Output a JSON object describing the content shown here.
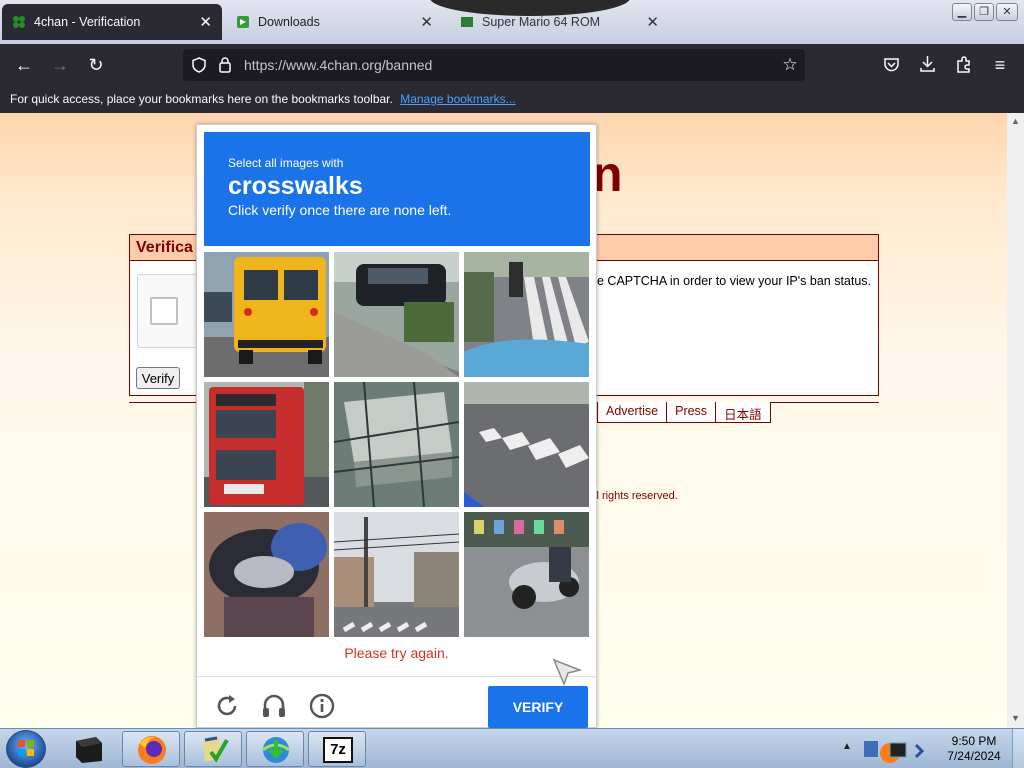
{
  "browser": {
    "tabs": [
      {
        "title": "4chan - Verification",
        "active": true,
        "icon": "4chan-clover-icon"
      },
      {
        "title": "Downloads",
        "active": false,
        "icon": "downloads-icon"
      },
      {
        "title": "Super Mario 64 ROM",
        "active": false,
        "icon": "rom-site-icon"
      }
    ],
    "url": "https://www.4chan.org/banned",
    "bookmarks_message": "For quick access, place your bookmarks here on the bookmarks toolbar.",
    "manage_bookmarks_label": "Manage bookmarks..."
  },
  "page": {
    "title_fragment": "n",
    "verification_heading": "Verifica",
    "ban_message": "e CAPTCHA in order to view your IP's ban status.",
    "verify_button": "Verify",
    "footer_links": [
      "Advertise",
      "Press",
      "日本語"
    ],
    "copyright": "ll rights reserved."
  },
  "captcha": {
    "instruction_small": "Select all images with",
    "target_word": "crosswalks",
    "instruction_sub": "Click verify once there are none left.",
    "error_message": "Please try again.",
    "verify_label": "VERIFY",
    "tiles": [
      "school-bus",
      "parked-car-street",
      "cyclist-crosswalk",
      "red-double-decker-bus",
      "building-overhead",
      "crosswalk-stripes",
      "motorcycle-closeup",
      "city-street-tower",
      "motorbike-rider"
    ]
  },
  "taskbar": {
    "time": "9:50 PM",
    "date": "7/24/2024",
    "apps": [
      "terminal",
      "firefox",
      "checklist",
      "ie-download",
      "7zip"
    ],
    "app_label_7z": "7z"
  },
  "colors": {
    "captcha_blue": "#1a73e8",
    "error_red": "#d93025",
    "page_maroon": "#800000",
    "browser_dark": "#2b2a33"
  }
}
